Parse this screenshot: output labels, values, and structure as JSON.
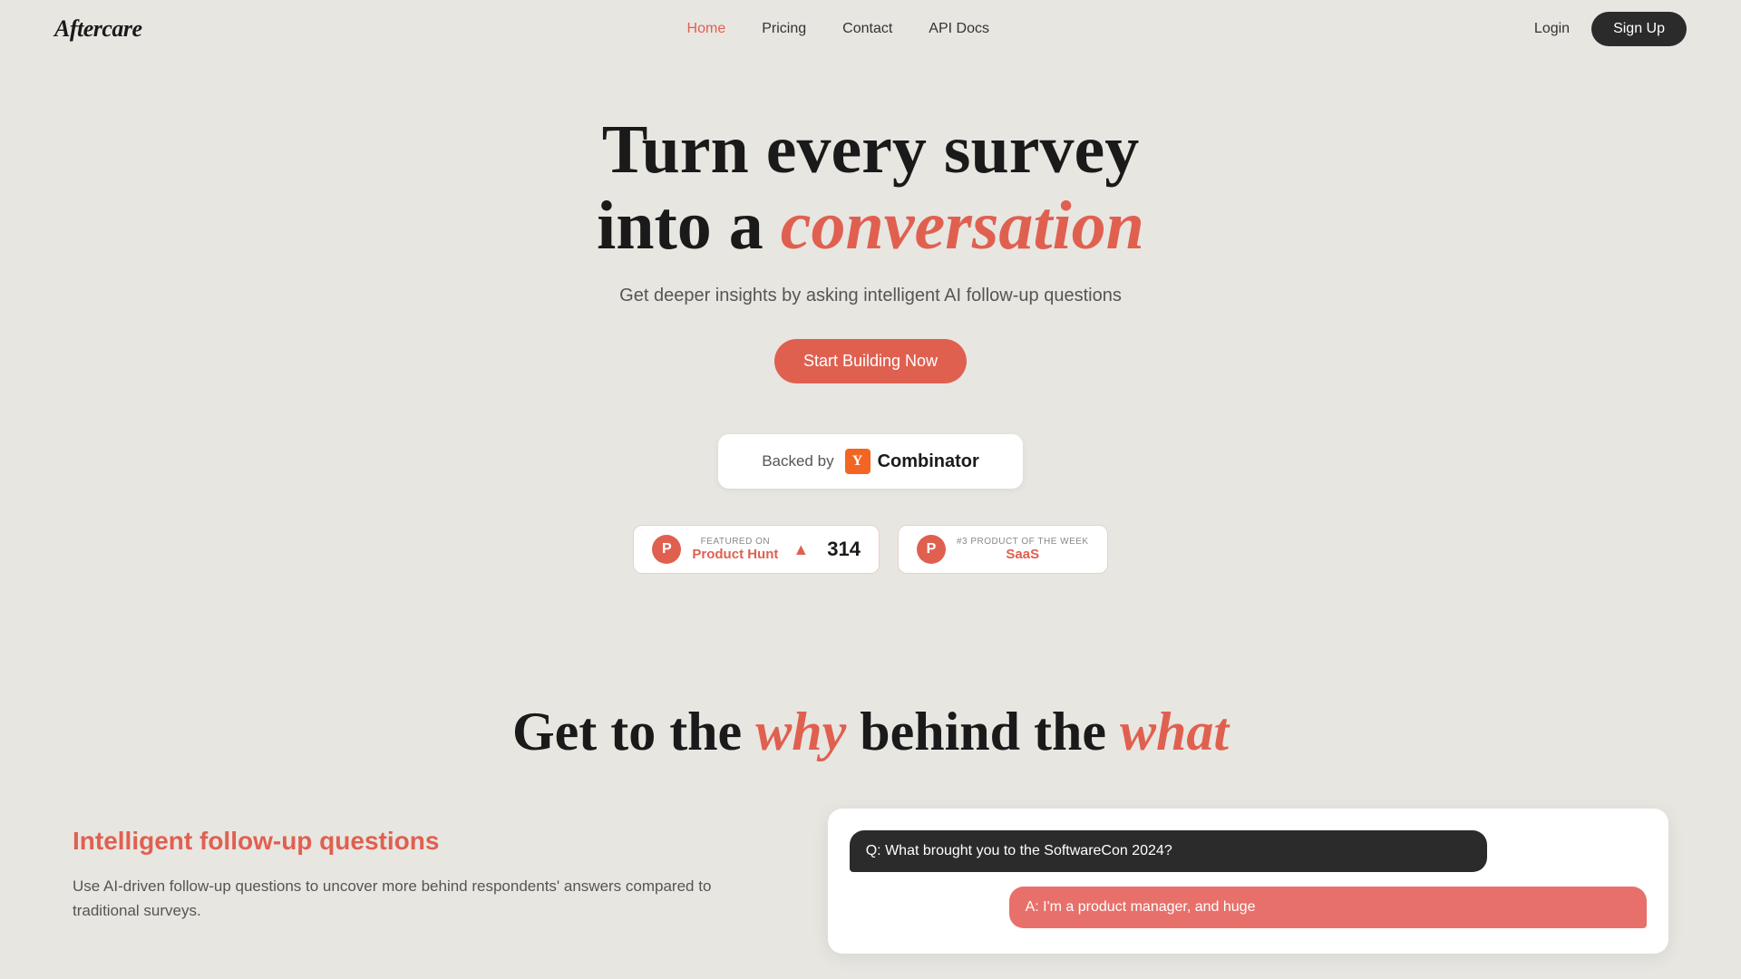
{
  "brand": {
    "name": "Aftercare",
    "name_prefix": "A",
    "name_rest": "ftercare"
  },
  "nav": {
    "links": [
      {
        "label": "Home",
        "active": true
      },
      {
        "label": "Pricing",
        "active": false
      },
      {
        "label": "Contact",
        "active": false
      },
      {
        "label": "API Docs",
        "active": false
      }
    ],
    "login_label": "Login",
    "signup_label": "Sign Up"
  },
  "hero": {
    "title_line1": "Turn every survey",
    "title_line2_prefix": "into a ",
    "title_line2_italic": "conversation",
    "subtitle": "Get deeper insights by asking intelligent AI follow-up questions",
    "cta_label": "Start Building Now",
    "backed_by_text": "Backed by",
    "yc_letter": "Y",
    "yc_name": "Combinator",
    "badges": [
      {
        "small_label": "FEATURED ON",
        "name": "Product Hunt",
        "number": "314"
      },
      {
        "small_label": "#3 PRODUCT OF THE WEEK",
        "name": "SaaS",
        "number": ""
      }
    ]
  },
  "section2": {
    "title_prefix": "Get to the ",
    "title_why": "why",
    "title_middle": " behind the ",
    "title_what": "what",
    "feature_title": "Intelligent follow-up questions",
    "feature_description": "Use AI-driven follow-up questions to uncover more behind respondents' answers compared to traditional surveys.",
    "chat": {
      "question": "Q: What brought you to the SoftwareCon 2024?",
      "answer": "A: I'm a product manager, and huge"
    }
  }
}
